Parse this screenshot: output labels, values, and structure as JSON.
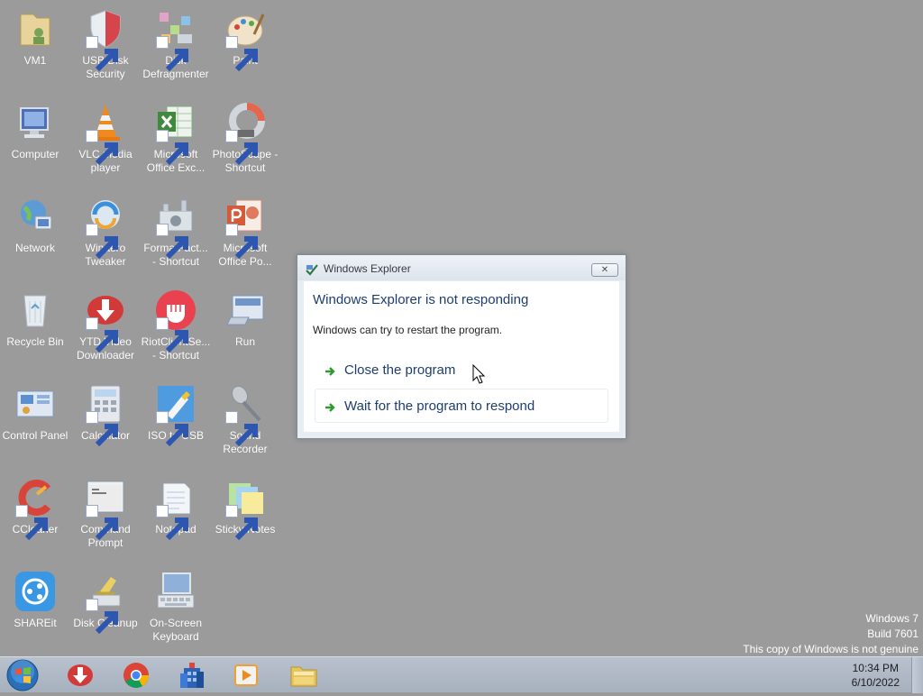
{
  "desktop_icons": [
    {
      "label": "VM1",
      "icon": "folder-user-icon"
    },
    {
      "label": "USB Disk Security",
      "icon": "shield-icon"
    },
    {
      "label": "Disk Defragmenter",
      "icon": "defragmenter-icon"
    },
    {
      "label": "Paint",
      "icon": "palette-icon"
    },
    {
      "label": "Computer",
      "icon": "computer-icon"
    },
    {
      "label": "VLC media player",
      "icon": "traffic-cone-icon"
    },
    {
      "label": "Microsoft Office Exc...",
      "icon": "excel-icon"
    },
    {
      "label": "PhotoScape - Shortcut",
      "icon": "photoscape-icon"
    },
    {
      "label": "Network",
      "icon": "network-globe-icon"
    },
    {
      "label": "Winaero Tweaker",
      "icon": "winaero-icon"
    },
    {
      "label": "FormatFact... - Shortcut",
      "icon": "format-factory-icon"
    },
    {
      "label": "Microsoft Office Po...",
      "icon": "powerpoint-icon"
    },
    {
      "label": "Recycle Bin",
      "icon": "recycle-bin-icon"
    },
    {
      "label": "YTD Video Downloader",
      "icon": "ytd-download-icon"
    },
    {
      "label": "RiotClientSe... - Shortcut",
      "icon": "riot-fist-icon"
    },
    {
      "label": "Run",
      "icon": "run-icon"
    },
    {
      "label": "Control Panel",
      "icon": "control-panel-icon"
    },
    {
      "label": "Calculator",
      "icon": "calculator-icon"
    },
    {
      "label": "ISO to USB",
      "icon": "usb-drive-icon"
    },
    {
      "label": "Sound Recorder",
      "icon": "microphone-icon"
    },
    {
      "label": "CCleaner",
      "icon": "ccleaner-icon"
    },
    {
      "label": "Command Prompt",
      "icon": "command-prompt-icon"
    },
    {
      "label": "Notepad",
      "icon": "notepad-icon"
    },
    {
      "label": "Sticky Notes",
      "icon": "sticky-notes-icon"
    },
    {
      "label": "SHAREit",
      "icon": "shareit-icon"
    },
    {
      "label": "Disk Cleanup",
      "icon": "disk-cleanup-icon"
    },
    {
      "label": "On-Screen Keyboard",
      "icon": "keyboard-icon"
    }
  ],
  "dialog": {
    "title": "Windows Explorer",
    "close_label": "✕",
    "heading": "Windows Explorer is not responding",
    "message": "Windows can try to restart the program.",
    "options": [
      {
        "label": "Close the program"
      },
      {
        "label": "Wait for the program to respond"
      }
    ]
  },
  "watermark": {
    "line1": "Windows 7",
    "line2": "Build 7601",
    "line3": "This copy of Windows is not genuine"
  },
  "taskbar": {
    "pinned": [
      "start-orb-icon",
      "ytd-download-icon",
      "chrome-icon",
      "building-icon",
      "media-player-icon",
      "folder-icon"
    ],
    "clock": {
      "time": "10:34 PM",
      "date": "6/10/2022"
    }
  },
  "colors": {
    "desktop_bg": "#9b9b9b",
    "dialog_heading": "#1c3e6f",
    "arrow_green": "#2f9a2f"
  }
}
